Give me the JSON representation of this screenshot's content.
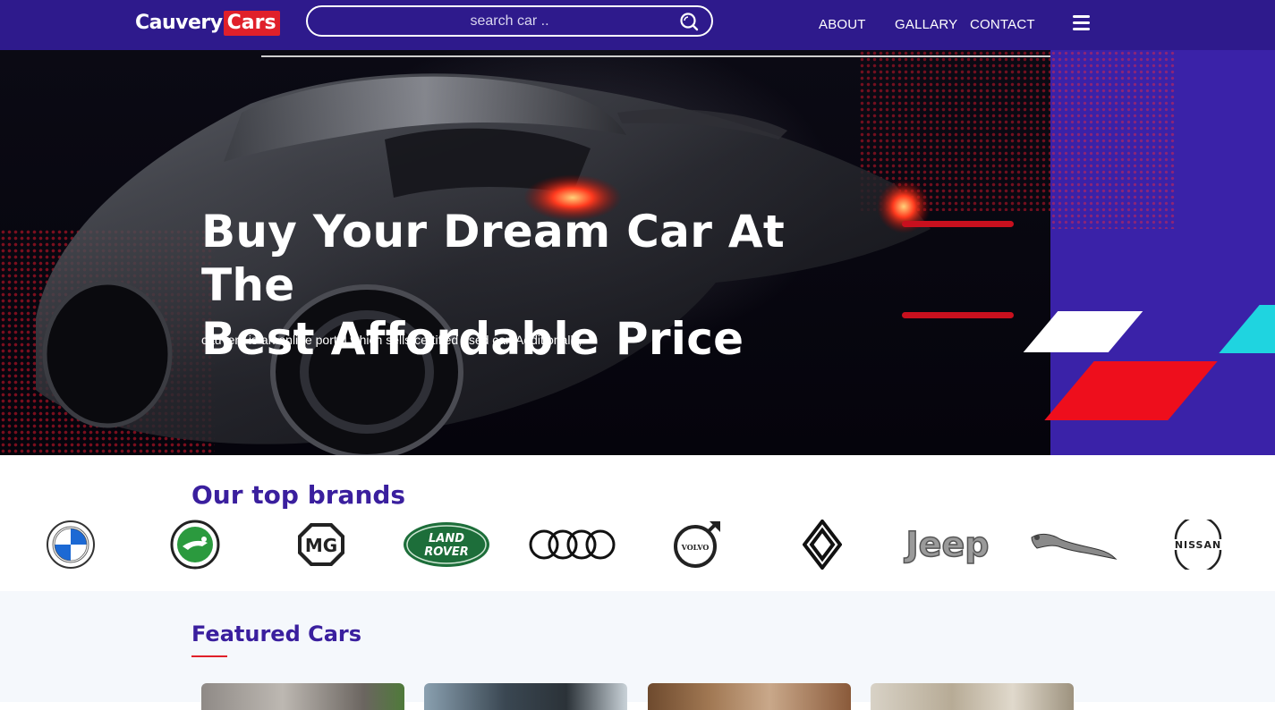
{
  "header": {
    "logo_part1": "Cauvery",
    "logo_part2": "Cars",
    "search_placeholder": "search car ..",
    "nav": [
      "ABOUT",
      "GALLARY",
      "CONTACT"
    ]
  },
  "hero": {
    "title_line1": "Buy Your Dream Car At The",
    "title_line2": "Best Affordable Price",
    "subtitle": "cauvery is an online portal which sells certified used car. Additionally,"
  },
  "brands": {
    "title": "Our top brands",
    "items": [
      "BMW",
      "Skoda",
      "MG",
      "LAND ROVER",
      "Audi",
      "VOLVO",
      "Renault",
      "Jeep",
      "Jaguar",
      "NISSAN"
    ]
  },
  "featured": {
    "title": "Featured Cars"
  },
  "colors": {
    "header_bg": "#2e1a8c",
    "accent_red": "#e0202a",
    "title_purple": "#3a1f9e",
    "hero_blue": "#3a22a8"
  }
}
